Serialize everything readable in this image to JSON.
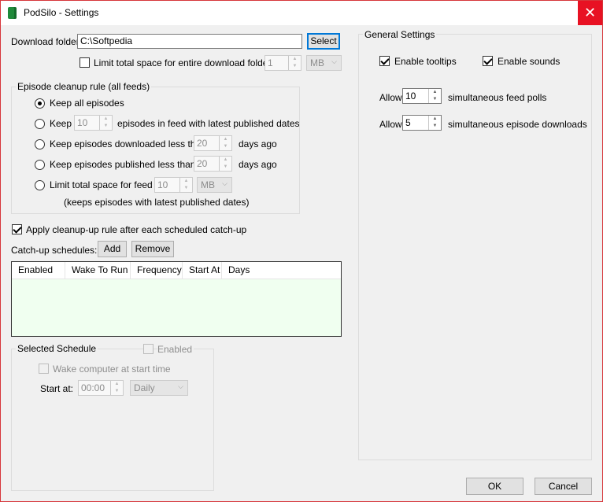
{
  "window": {
    "title": "PodSilo - Settings",
    "close_glyph": "✕"
  },
  "download": {
    "label": "Download folder:",
    "path": "C:\\Softpedia",
    "select_label": "Select",
    "limit_label": "Limit total space for entire download folder to",
    "limit_value": "1",
    "limit_unit": "MB"
  },
  "cleanup": {
    "title": "Episode cleanup rule (all feeds)",
    "keep_all": "Keep all episodes",
    "keep_n_prefix": "Keep",
    "keep_n_value": "10",
    "keep_n_suffix": "episodes in feed with latest published dates",
    "downloaded_prefix": "Keep episodes downloaded less than",
    "downloaded_value": "20",
    "downloaded_suffix": "days ago",
    "published_prefix": "Keep episodes published less than",
    "published_value": "20",
    "published_suffix": "days ago",
    "limit_prefix": "Limit total space for feed to",
    "limit_value": "10",
    "limit_unit": "MB",
    "limit_note": "(keeps episodes with latest published dates)"
  },
  "apply_label": "Apply cleanup-up rule after each scheduled catch-up",
  "schedules": {
    "label": "Catch-up schedules:",
    "add_label": "Add",
    "remove_label": "Remove",
    "columns": [
      "Enabled",
      "Wake To Run",
      "Frequency",
      "Start At",
      "Days"
    ]
  },
  "selected": {
    "title": "Selected Schedule",
    "enabled_label": "Enabled",
    "wake_label": "Wake computer at start time",
    "start_label": "Start at:",
    "start_value": "00:00",
    "frequency_value": "Daily"
  },
  "general": {
    "title": "General Settings",
    "tooltips_label": "Enable tooltips",
    "sounds_label": "Enable sounds",
    "allow_label": "Allow",
    "polls_value": "10",
    "polls_suffix": "simultaneous feed polls",
    "downloads_value": "5",
    "downloads_suffix": "simultaneous episode downloads"
  },
  "footer": {
    "ok_label": "OK",
    "cancel_label": "Cancel"
  },
  "icons": {
    "spin_up": "▲",
    "spin_down": "▼",
    "dropdown": "⌵"
  }
}
